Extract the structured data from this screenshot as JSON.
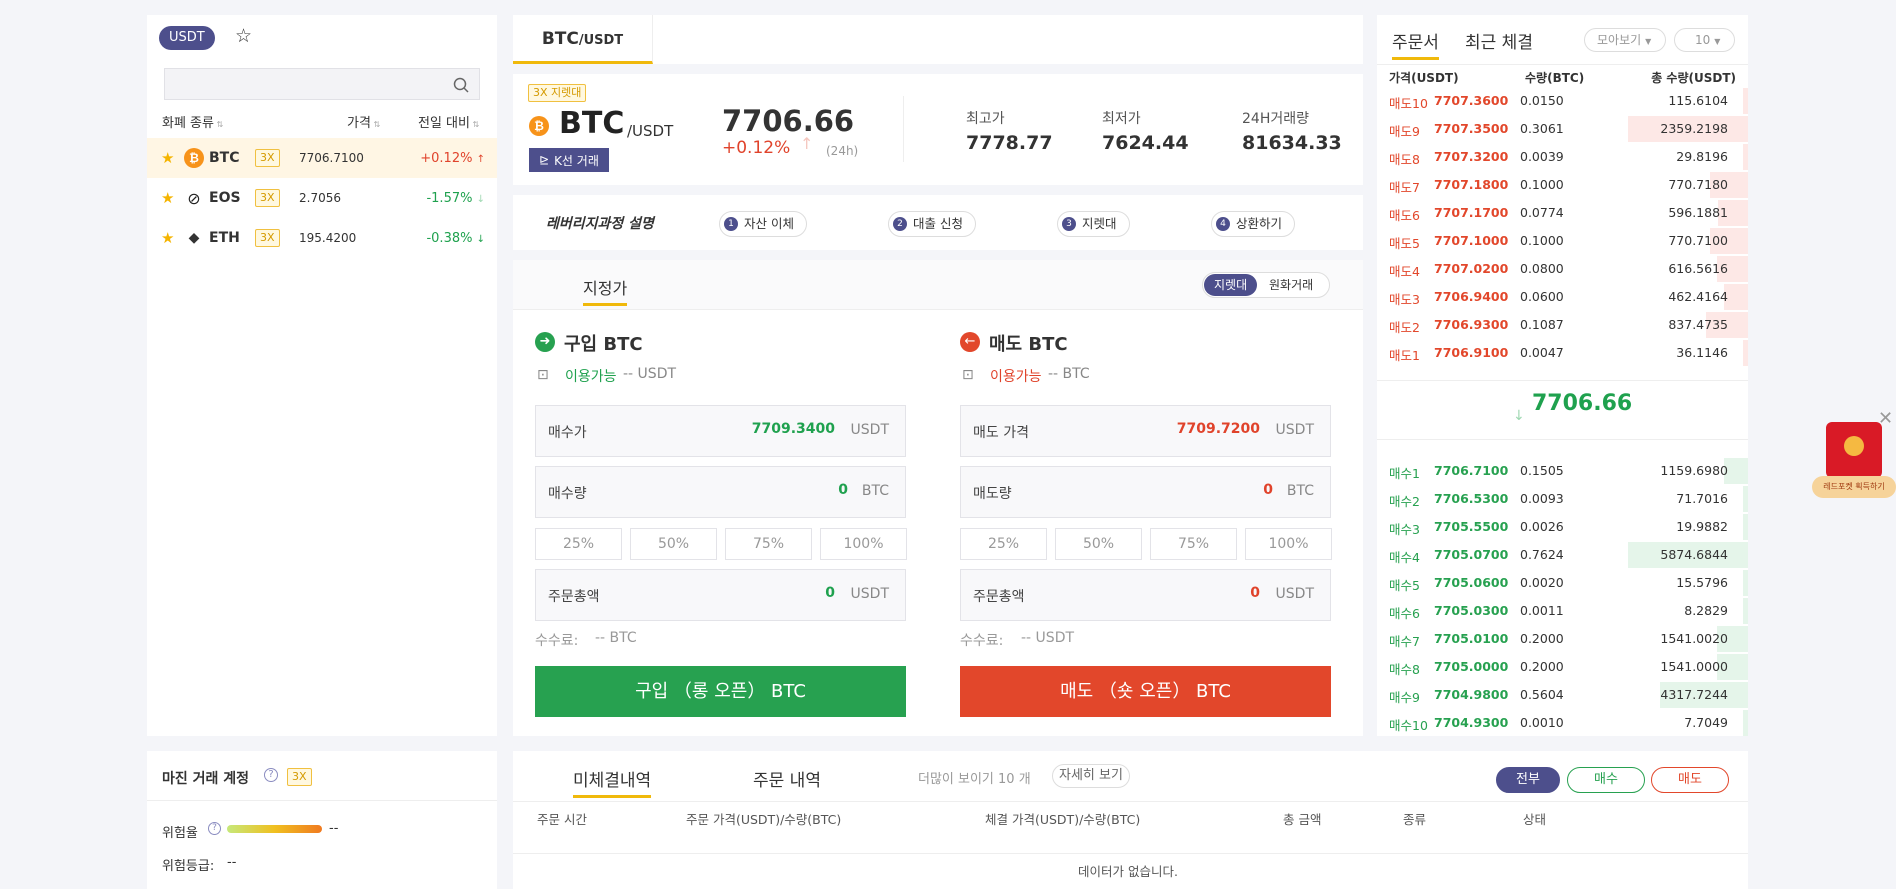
{
  "left": {
    "quote_tab": "USDT",
    "headers": {
      "coin": "화폐 종류",
      "price": "가격",
      "change": "전일 대비"
    },
    "coins": [
      {
        "symbol": "BTC",
        "leverage": "3X",
        "price": "7706.7100",
        "change": "+0.12%",
        "dir": "up"
      },
      {
        "symbol": "EOS",
        "leverage": "3X",
        "price": "2.7056",
        "change": "-1.57%",
        "dir": "down"
      },
      {
        "symbol": "ETH",
        "leverage": "3X",
        "price": "195.4200",
        "change": "-0.38%",
        "dir": "down"
      }
    ]
  },
  "pair_tab": {
    "base": "BTC",
    "quote": "/USDT"
  },
  "ticker": {
    "badge": "3X 지렛대",
    "symbol": "BTC",
    "quote": "/USDT",
    "kline_button": "K선 거래",
    "last_price": "7706.66",
    "change": "+0.12%",
    "period": "(24h)",
    "stats": [
      {
        "label": "최고가",
        "value": "7778.77"
      },
      {
        "label": "최저가",
        "value": "7624.44"
      },
      {
        "label": "24H거래량",
        "value": "81634.33"
      }
    ]
  },
  "leverage_steps": {
    "title": "레버리지과정 설명",
    "steps": [
      {
        "num": "1",
        "label": "자산 이체"
      },
      {
        "num": "2",
        "label": "대출 신청"
      },
      {
        "num": "3",
        "label": "지렛대"
      },
      {
        "num": "4",
        "label": "상환하기"
      }
    ]
  },
  "order_form": {
    "tab": "지정가",
    "mode_leverage": "지렛대",
    "mode_spot": "원화거래",
    "percents": [
      "25%",
      "50%",
      "75%",
      "100%"
    ],
    "buy": {
      "title": "구입 BTC",
      "avail_label": "이용가능",
      "avail_value": "-- USDT",
      "price_label": "매수가",
      "price_value": "7709.3400",
      "price_unit": "USDT",
      "qty_label": "매수량",
      "qty_value": "0",
      "qty_unit": "BTC",
      "total_label": "주문총액",
      "total_value": "0",
      "total_unit": "USDT",
      "fee_label": "수수료:",
      "fee_value": "-- BTC",
      "submit": "구입 （롱 오픈） BTC"
    },
    "sell": {
      "title": "매도 BTC",
      "avail_label": "이용가능",
      "avail_value": "-- BTC",
      "price_label": "매도 가격",
      "price_value": "7709.7200",
      "price_unit": "USDT",
      "qty_label": "매도량",
      "qty_value": "0",
      "qty_unit": "BTC",
      "total_label": "주문총액",
      "total_value": "0",
      "total_unit": "USDT",
      "fee_label": "수수료:",
      "fee_value": "-- USDT",
      "submit": "매도 （숏 오픈） BTC"
    }
  },
  "orderbook": {
    "tab_book": "주문서",
    "tab_trades": "최근 체결",
    "group_select": "모아보기",
    "depth_select": "10",
    "headers": {
      "price": "가격(USDT)",
      "qty": "수량(BTC)",
      "total": "총 수량(USDT)"
    },
    "asks": [
      {
        "level": "매도10",
        "price": "7707.3600",
        "qty": "0.0150",
        "total": "115.6104",
        "depth": 0.04
      },
      {
        "level": "매도9",
        "price": "7707.3500",
        "qty": "0.3061",
        "total": "2359.2198",
        "depth": 1.0
      },
      {
        "level": "매도8",
        "price": "7707.3200",
        "qty": "0.0039",
        "total": "29.8196",
        "depth": 0.04
      },
      {
        "level": "매도7",
        "price": "7707.1800",
        "qty": "0.1000",
        "total": "770.7180",
        "depth": 0.32
      },
      {
        "level": "매도6",
        "price": "7707.1700",
        "qty": "0.0774",
        "total": "596.1881",
        "depth": 0.25
      },
      {
        "level": "매도5",
        "price": "7707.1000",
        "qty": "0.1000",
        "total": "770.7100",
        "depth": 0.32
      },
      {
        "level": "매도4",
        "price": "7707.0200",
        "qty": "0.0800",
        "total": "616.5616",
        "depth": 0.26
      },
      {
        "level": "매도3",
        "price": "7706.9400",
        "qty": "0.0600",
        "total": "462.4164",
        "depth": 0.2
      },
      {
        "level": "매도2",
        "price": "7706.9300",
        "qty": "0.1087",
        "total": "837.4735",
        "depth": 0.35
      },
      {
        "level": "매도1",
        "price": "7706.9100",
        "qty": "0.0047",
        "total": "36.1146",
        "depth": 0.04
      }
    ],
    "mid_price": "7706.66",
    "bids": [
      {
        "level": "매수1",
        "price": "7706.7100",
        "qty": "0.1505",
        "total": "1159.6980",
        "depth": 0.2
      },
      {
        "level": "매수2",
        "price": "7706.5300",
        "qty": "0.0093",
        "total": "71.7016",
        "depth": 0.04
      },
      {
        "level": "매수3",
        "price": "7705.5500",
        "qty": "0.0026",
        "total": "19.9882",
        "depth": 0.04
      },
      {
        "level": "매수4",
        "price": "7705.0700",
        "qty": "0.7624",
        "total": "5874.6844",
        "depth": 1.0
      },
      {
        "level": "매수5",
        "price": "7705.0600",
        "qty": "0.0020",
        "total": "15.5796",
        "depth": 0.04
      },
      {
        "level": "매수6",
        "price": "7705.0300",
        "qty": "0.0011",
        "total": "8.2829",
        "depth": 0.04
      },
      {
        "level": "매수7",
        "price": "7705.0100",
        "qty": "0.2000",
        "total": "1541.0020",
        "depth": 0.26
      },
      {
        "level": "매수8",
        "price": "7705.0000",
        "qty": "0.2000",
        "total": "1541.0000",
        "depth": 0.26
      },
      {
        "level": "매수9",
        "price": "7704.9800",
        "qty": "0.5604",
        "total": "4317.7244",
        "depth": 0.73
      },
      {
        "level": "매수10",
        "price": "7704.9300",
        "qty": "0.0010",
        "total": "7.7049",
        "depth": 0.04
      }
    ]
  },
  "margin": {
    "title": "마진 거래 계정",
    "leverage": "3X",
    "risk_label": "위험율",
    "risk_value": "--",
    "grade_label": "위험등급:",
    "grade_value": "--"
  },
  "orders": {
    "tab_open": "미체결내역",
    "tab_history": "주문 내역",
    "more_text": "더많이 보이기 10 개",
    "detail_button": "자세히 보기",
    "filter_all": "전부",
    "filter_buy": "매수",
    "filter_sell": "매도",
    "headers": [
      "주문 시간",
      "주문 가격(USDT)/수량(BTC)",
      "체결 가격(USDT)/수량(BTC)",
      "총 금액",
      "종류",
      "상태"
    ],
    "empty": "데이터가 없습니다."
  },
  "promo": {
    "text": "레드포켓 획득하기"
  },
  "colors": {
    "accent": "#4d4f8c",
    "buy": "#27a150",
    "sell": "#e2472b",
    "gold": "#f0b90b"
  }
}
